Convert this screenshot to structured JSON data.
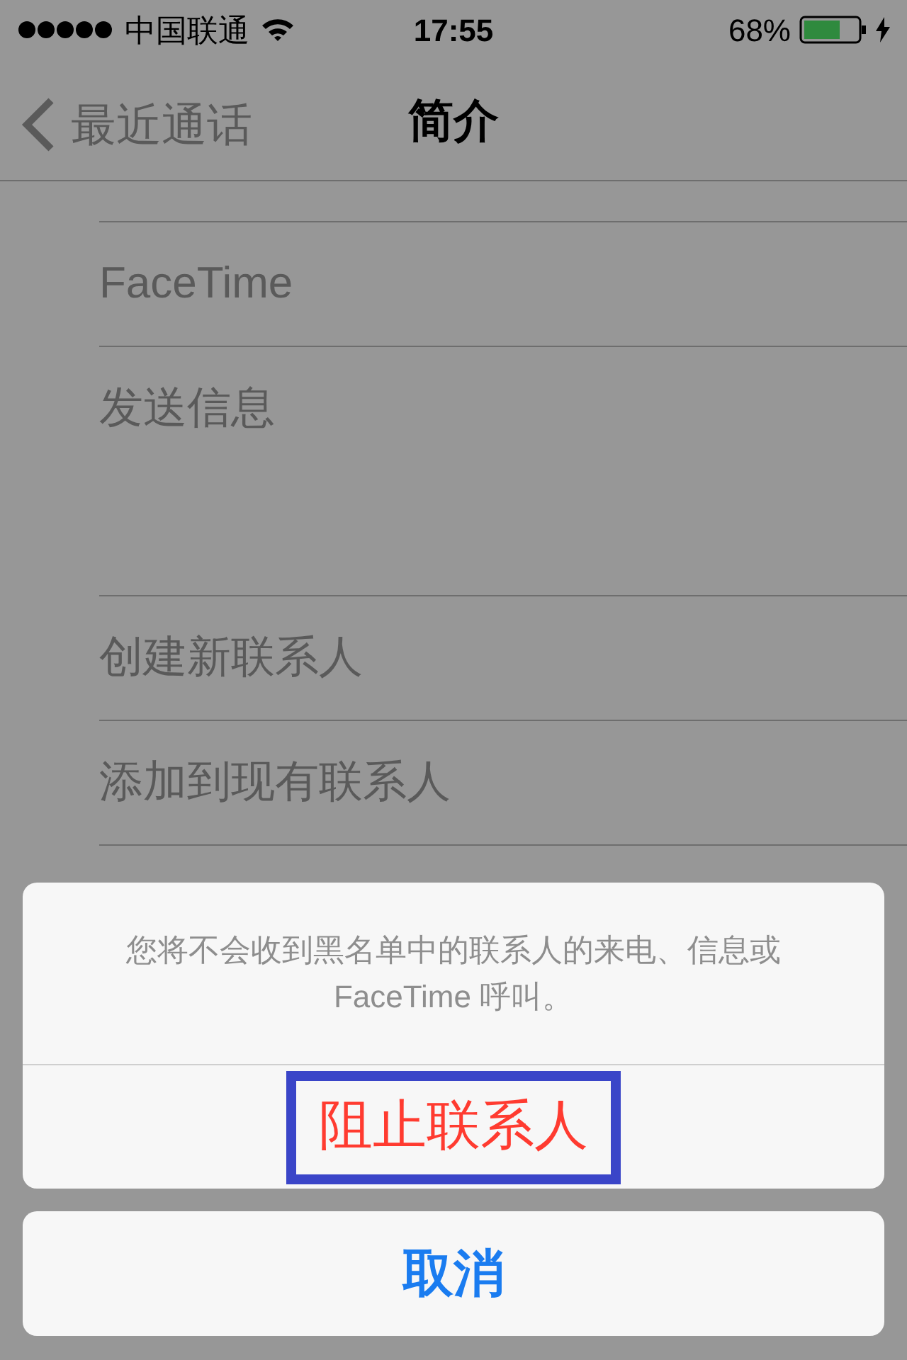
{
  "status_bar": {
    "carrier": "中国联通",
    "time": "17:55",
    "battery": "68%"
  },
  "nav_bar": {
    "back": "最近通话",
    "title": "简介"
  },
  "sections": [
    {
      "rows": [
        "FaceTime",
        "发送信息"
      ]
    },
    {
      "rows": [
        "创建新联系人",
        "添加到现有联系人",
        ""
      ]
    }
  ],
  "action_sheet": {
    "message": "您将不会收到黑名单中的联系人的来电、信息或 FaceTime 呼叫。",
    "actions": [
      {
        "label": "阻止联系人",
        "kind": "destructive",
        "highlighted": true
      }
    ],
    "cancel": "取消"
  }
}
